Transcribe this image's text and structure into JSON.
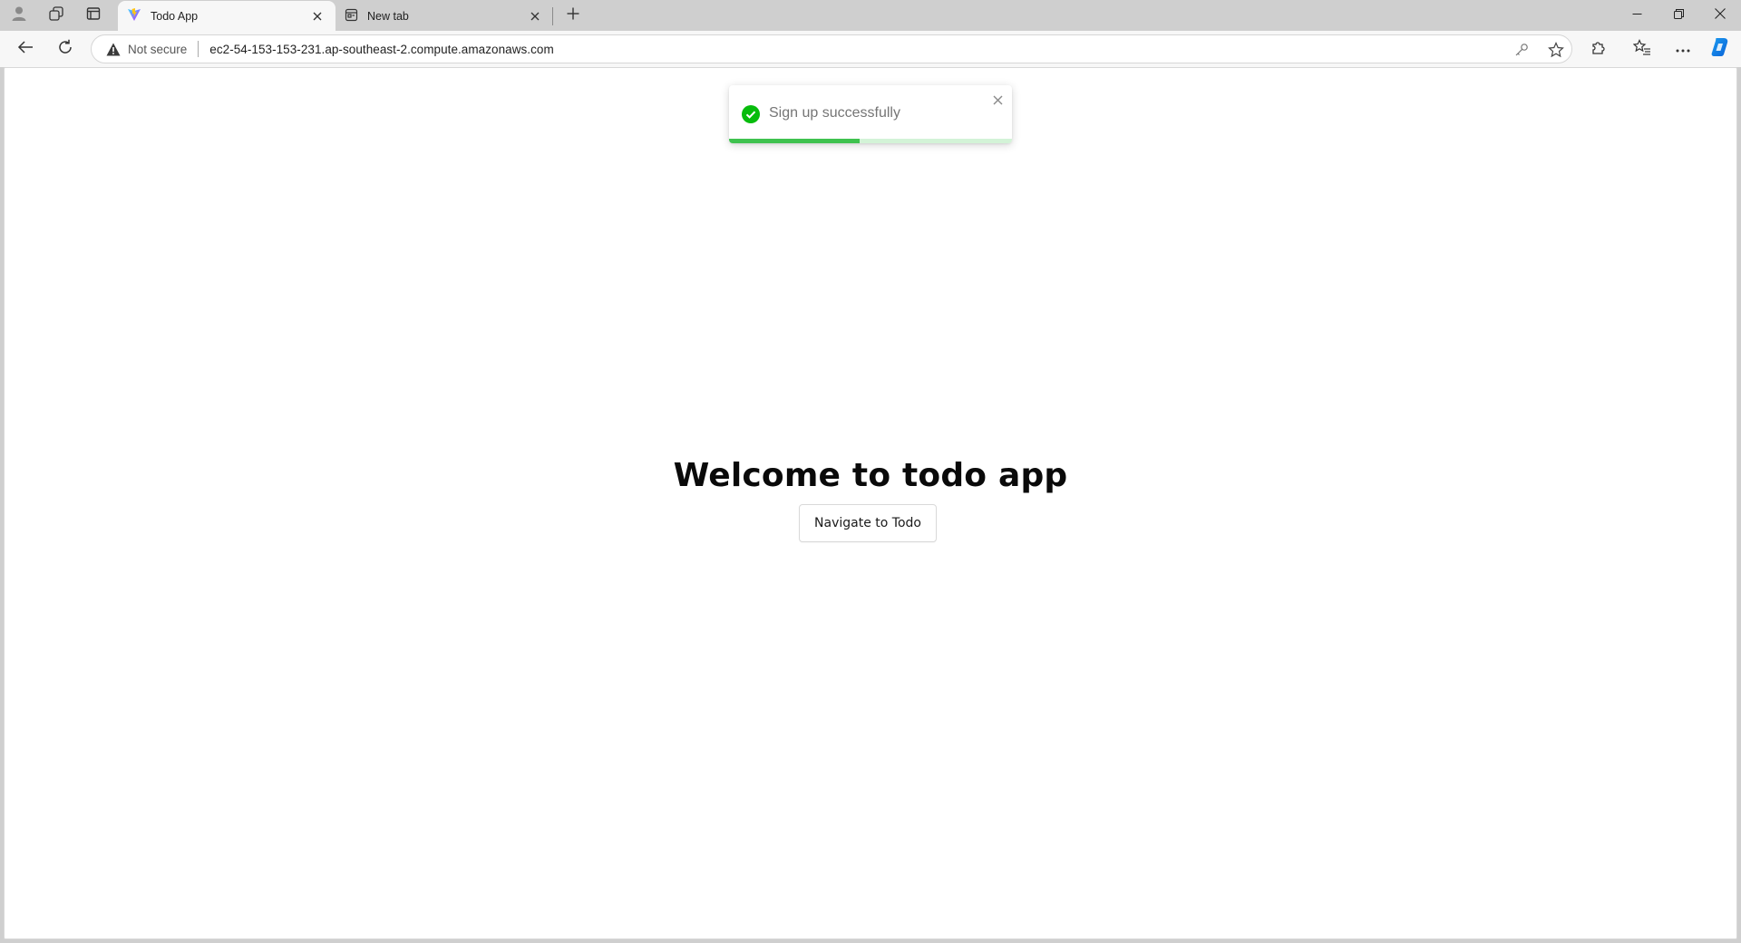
{
  "browser": {
    "tabs": [
      {
        "title": "Todo App",
        "icon": "vite-logo-icon",
        "active": true
      },
      {
        "title": "New tab",
        "icon": "new-tab-page-icon",
        "active": false
      }
    ],
    "address_bar": {
      "security_label": "Not secure",
      "url": "ec2-54-153-153-231.ap-southeast-2.compute.amazonaws.com"
    },
    "colors": {
      "accent": "#3fc24f",
      "chrome": "#cfcfcf",
      "toolbar": "#f7f7f7"
    }
  },
  "page": {
    "toast": {
      "message": "Sign up successfully",
      "status": "success",
      "progress_fraction": 0.46
    },
    "heading": "Welcome to todo app",
    "navigate_button": "Navigate to Todo"
  }
}
